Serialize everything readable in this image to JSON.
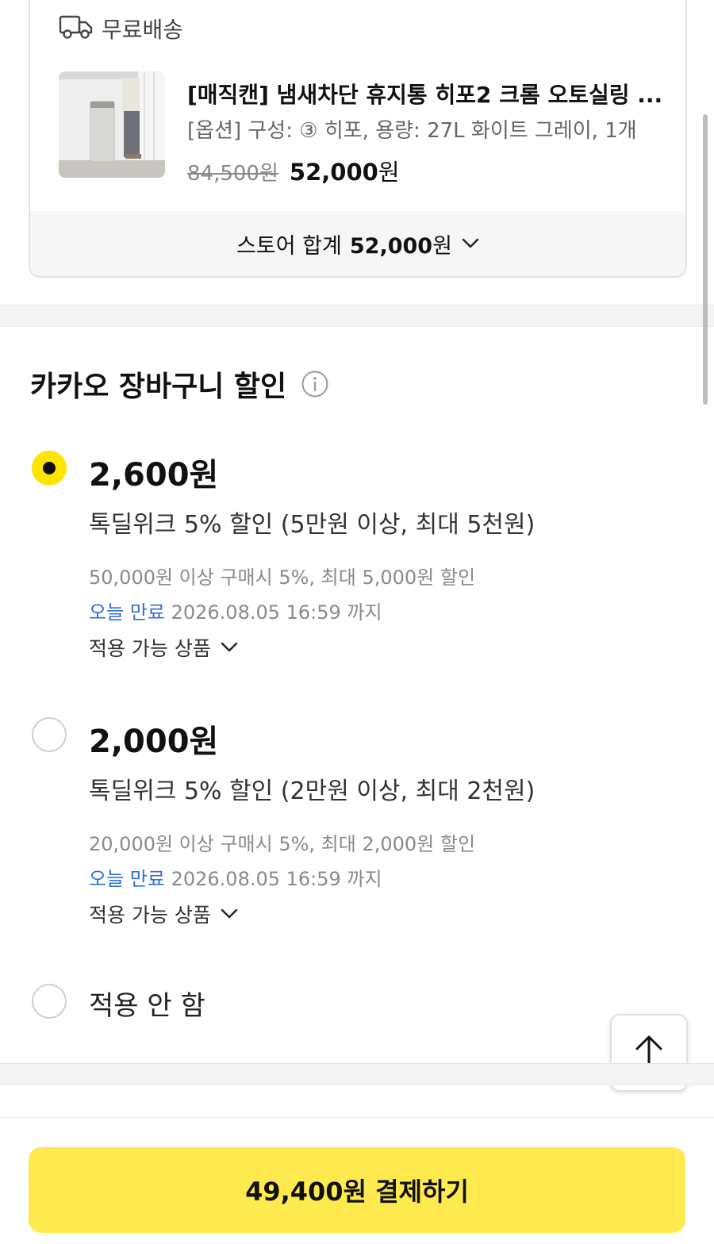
{
  "store": {
    "shipping_label": "무료배송",
    "product_title": "[매직캔] 냄새차단 휴지통 히포2 크롬 오토실링 ...",
    "product_option": "[옵션] 구성: ③ 히포, 용량: 27L 화이트 그레이, 1개",
    "original_price": "84,500원",
    "sale_price_number": "52,000",
    "sale_price_unit": "원",
    "total_label": "스토어 합계",
    "total_amount_number": "52,000",
    "total_amount_unit": "원"
  },
  "discount": {
    "title": "카카오 장바구니 할인",
    "options": [
      {
        "selected": true,
        "amount": "2,600원",
        "name": "톡딜위크 5% 할인 (5만원 이상, 최대 5천원)",
        "desc": "50,000원 이상 구매시 5%, 최대 5,000원 할인",
        "expiry_tag": "오늘 만료",
        "expiry": "2026.08.05 16:59 까지",
        "apply_label": "적용 가능 상품"
      },
      {
        "selected": false,
        "amount": "2,000원",
        "name": "톡딜위크 5% 할인 (2만원 이상, 최대 2천원)",
        "desc": "20,000원 이상 구매시 5%, 최대 2,000원 할인",
        "expiry_tag": "오늘 만료",
        "expiry": "2026.08.05 16:59 까지",
        "apply_label": "적용 가능 상품"
      }
    ],
    "none_label": "적용 안 함"
  },
  "pay": {
    "button_label": "49,400원 결제하기"
  },
  "colors": {
    "accent_yellow": "#fee500",
    "pay_button": "#fee94e",
    "expiry_blue": "#2f6fd6"
  }
}
